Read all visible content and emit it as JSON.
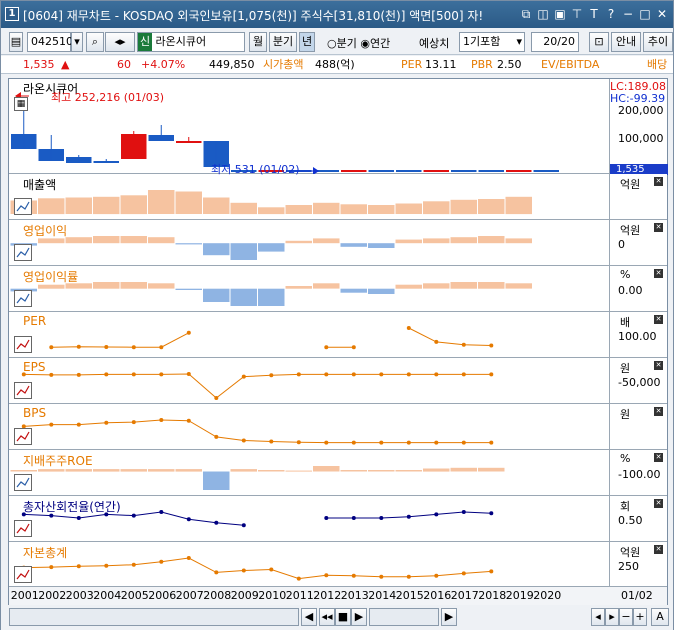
{
  "title": {
    "app_num": "1",
    "text": "[0604] 재무차트 - KOSDAQ 외국인보유[1,075(천)] 주식수[31,810(천)] 액면[500] 자!"
  },
  "toolbar": {
    "code": "042510",
    "sin_label": "신",
    "name": "라온시큐어",
    "monthly": "월",
    "quarterly": "분기",
    "yearly": "년",
    "radio_quarter": "분기",
    "radio_year": "연간",
    "forecast_label": "예상치",
    "forecast_value": "1기포함",
    "page": "20/20",
    "guide": "안내",
    "add": "추이"
  },
  "info": {
    "price": "1,535",
    "change": "60",
    "change_pct": "+4.07%",
    "volume": "449,850",
    "mcap_label": "시가총액",
    "mcap_value": "488(억)",
    "per_label": "PER",
    "per_value": "13.11",
    "pbr_label": "PBR",
    "pbr_value": "2.50",
    "ev_label": "EV/EBITDA",
    "div_label": "배당"
  },
  "price_panel": {
    "label": "라온시큐어",
    "high_note": "최고 252,216 (01/03)",
    "low_note": "최저 531 (01/02)",
    "lc": "LC:189.08",
    "hc": "HC:-99.39",
    "ticks": [
      "200,000",
      "100,000"
    ],
    "last": "1,535"
  },
  "panels": [
    {
      "label": "매출액",
      "unit": "억원",
      "ticks": [],
      "color": "#e57a00"
    },
    {
      "label": "영업이익",
      "unit": "억원",
      "ticks": [
        "0"
      ],
      "color": "#e57a00"
    },
    {
      "label": "영업이익률",
      "unit": "%",
      "ticks": [
        "0.00"
      ],
      "color": "#e57a00"
    },
    {
      "label": "PER",
      "unit": "배",
      "ticks": [
        "100.00"
      ],
      "color": "#e57a00"
    },
    {
      "label": "EPS",
      "unit": "원",
      "ticks": [
        "-50,000"
      ],
      "color": "#e57a00"
    },
    {
      "label": "BPS",
      "unit": "원",
      "ticks": [],
      "color": "#e57a00"
    },
    {
      "label": "지배주주ROE",
      "unit": "%",
      "ticks": [
        "-100.00"
      ],
      "color": "#e57a00"
    },
    {
      "label": "총자산회전율(연간)",
      "unit": "회",
      "ticks": [
        "0.50"
      ],
      "color": "#000080"
    },
    {
      "label": "자본총계",
      "unit": "억원",
      "ticks": [
        "250"
      ],
      "color": "#e57a00"
    }
  ],
  "years": [
    "2001",
    "2002",
    "2003",
    "2004",
    "2005",
    "2006",
    "2007",
    "2008",
    "2009",
    "2010",
    "2011",
    "2012",
    "2013",
    "2014",
    "2015",
    "2016",
    "2017",
    "2018",
    "2019",
    "2020"
  ],
  "date_label": "01/02",
  "chart_data": [
    {
      "type": "bar",
      "title": "매출액",
      "categories": [
        "2001",
        "2002",
        "2003",
        "2004",
        "2005",
        "2006",
        "2007",
        "2008",
        "2009",
        "2010",
        "2011",
        "2012",
        "2013",
        "2014",
        "2015",
        "2016",
        "2017",
        "2018",
        "2019",
        "2020"
      ],
      "values": [
        18,
        21,
        22,
        23,
        25,
        32,
        30,
        22,
        15,
        9,
        12,
        15,
        13,
        12,
        14,
        17,
        19,
        20,
        23,
        null
      ]
    },
    {
      "type": "bar",
      "title": "영업이익",
      "categories": [
        "2001",
        "2002",
        "2003",
        "2004",
        "2005",
        "2006",
        "2007",
        "2008",
        "2009",
        "2010",
        "2011",
        "2012",
        "2013",
        "2014",
        "2015",
        "2016",
        "2017",
        "2018",
        "2019",
        "2020"
      ],
      "values": [
        -2,
        4,
        5,
        6,
        6,
        5,
        -1,
        -10,
        -14,
        -7,
        2,
        4,
        -3,
        -4,
        3,
        4,
        5,
        6,
        4,
        null
      ]
    },
    {
      "type": "bar",
      "title": "영업이익률",
      "categories": [
        "2001",
        "2002",
        "2003",
        "2004",
        "2005",
        "2006",
        "2007",
        "2008",
        "2009",
        "2010",
        "2011",
        "2012",
        "2013",
        "2014",
        "2015",
        "2016",
        "2017",
        "2018",
        "2019",
        "2020"
      ],
      "values": [
        -2,
        3,
        4,
        5,
        5,
        4,
        -1,
        -10,
        -13,
        -13,
        2,
        4,
        -3,
        -4,
        3,
        4,
        5,
        5,
        4,
        null
      ]
    },
    {
      "type": "line",
      "title": "PER",
      "categories": [
        "2001",
        "2002",
        "2003",
        "2004",
        "2005",
        "2006",
        "2007",
        "2008",
        "2009",
        "2010",
        "2011",
        "2012",
        "2013",
        "2014",
        "2015",
        "2016",
        "2017",
        "2018",
        "2019",
        "2020"
      ],
      "values": [
        null,
        20,
        22,
        21,
        20,
        20,
        80,
        null,
        null,
        null,
        null,
        20,
        20,
        null,
        100,
        42,
        30,
        27,
        null,
        null
      ]
    },
    {
      "type": "line",
      "title": "EPS",
      "categories": [
        "2001",
        "2002",
        "2003",
        "2004",
        "2005",
        "2006",
        "2007",
        "2008",
        "2009",
        "2010",
        "2011",
        "2012",
        "2013",
        "2014",
        "2015",
        "2016",
        "2017",
        "2018",
        "2019",
        "2020"
      ],
      "values": [
        0,
        -1,
        -1,
        0,
        0,
        0,
        1,
        -55,
        -5,
        -2,
        0,
        0,
        0,
        0,
        0,
        0,
        0,
        0,
        null,
        null
      ]
    },
    {
      "type": "line",
      "title": "BPS",
      "categories": [
        "2001",
        "2002",
        "2003",
        "2004",
        "2005",
        "2006",
        "2007",
        "2008",
        "2009",
        "2010",
        "2011",
        "2012",
        "2013",
        "2014",
        "2015",
        "2016",
        "2017",
        "2018",
        "2019",
        "2020"
      ],
      "values": [
        50,
        55,
        55,
        60,
        62,
        68,
        66,
        20,
        10,
        7,
        5,
        4,
        4,
        4,
        4,
        4,
        4,
        4,
        null,
        null
      ]
    },
    {
      "type": "bar",
      "title": "지배주주ROE",
      "categories": [
        "2001",
        "2002",
        "2003",
        "2004",
        "2005",
        "2006",
        "2007",
        "2008",
        "2009",
        "2010",
        "2011",
        "2012",
        "2013",
        "2014",
        "2015",
        "2016",
        "2017",
        "2018",
        "2019",
        "2020"
      ],
      "values": [
        5,
        8,
        8,
        8,
        8,
        8,
        8,
        -60,
        8,
        5,
        3,
        18,
        5,
        5,
        5,
        10,
        12,
        12,
        null,
        null
      ]
    },
    {
      "type": "line",
      "title": "총자산회전율(연간)",
      "categories": [
        "2001",
        "2002",
        "2003",
        "2004",
        "2005",
        "2006",
        "2007",
        "2008",
        "2009",
        "2010",
        "2011",
        "2012",
        "2013",
        "2014",
        "2015",
        "2016",
        "2017",
        "2018",
        "2019",
        "2020"
      ],
      "values": [
        0.9,
        0.85,
        0.75,
        0.9,
        0.85,
        1.0,
        0.7,
        0.55,
        0.45,
        null,
        null,
        0.75,
        0.75,
        0.75,
        0.8,
        0.9,
        1.0,
        0.95,
        null,
        null
      ]
    },
    {
      "type": "line",
      "title": "자본총계",
      "categories": [
        "2001",
        "2002",
        "2003",
        "2004",
        "2005",
        "2006",
        "2007",
        "2008",
        "2009",
        "2010",
        "2011",
        "2012",
        "2013",
        "2014",
        "2015",
        "2016",
        "2017",
        "2018",
        "2019",
        "2020"
      ],
      "values": [
        300,
        310,
        330,
        340,
        360,
        420,
        500,
        200,
        240,
        260,
        70,
        140,
        130,
        110,
        110,
        130,
        180,
        220,
        null,
        null
      ]
    }
  ]
}
